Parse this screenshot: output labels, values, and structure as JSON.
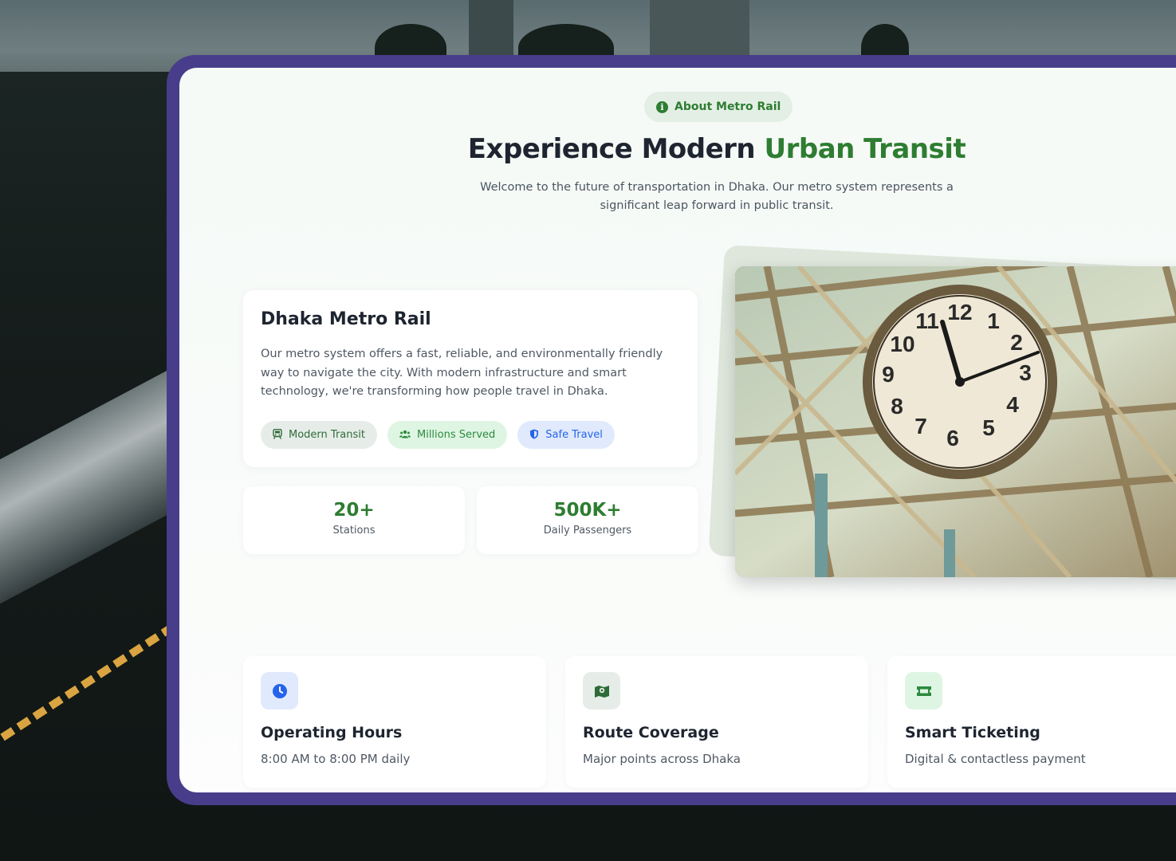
{
  "badge": {
    "icon": "info-icon",
    "label": "About Metro Rail"
  },
  "hero": {
    "title_main": "Experience Modern ",
    "title_accent": "Urban Transit",
    "subtitle": "Welcome to the future of transportation in Dhaka. Our metro system represents a significant leap forward in public transit."
  },
  "info_card": {
    "title": "Dhaka Metro Rail",
    "description": "Our metro system offers a fast, reliable, and environmentally friendly way to navigate the city. With modern infrastructure and smart technology, we're transforming how people travel in Dhaka.",
    "chips": [
      {
        "icon": "train-icon",
        "label": "Modern Transit"
      },
      {
        "icon": "users-icon",
        "label": "Millions Served"
      },
      {
        "icon": "shield-icon",
        "label": "Safe Travel"
      }
    ]
  },
  "stats": [
    {
      "value": "20+",
      "label": "Stations"
    },
    {
      "value": "500K+",
      "label": "Daily Passengers"
    }
  ],
  "image": {
    "subject": "station clock under steel roof"
  },
  "features": [
    {
      "icon": "clock-icon",
      "title": "Operating Hours",
      "description": "8:00 AM to 8:00 PM daily"
    },
    {
      "icon": "map-icon",
      "title": "Route Coverage",
      "description": "Major points across Dhaka"
    },
    {
      "icon": "ticket-icon",
      "title": "Smart Ticketing",
      "description": "Digital & contactless payment"
    }
  ],
  "colors": {
    "accent": "#2e7d32",
    "frame": "#483d8a",
    "blue": "#2563eb"
  }
}
